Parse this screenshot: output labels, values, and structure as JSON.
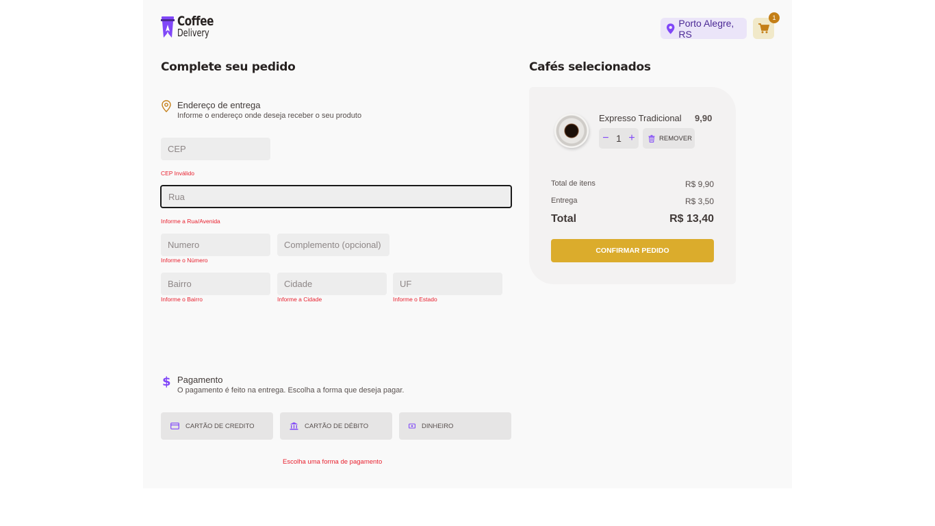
{
  "header": {
    "logo_line1": "Coffee",
    "logo_line2": "Delivery",
    "location": "Porto Alegre, RS",
    "cart_count": "1"
  },
  "order": {
    "title": "Complete seu pedido",
    "address": {
      "heading": "Endereço de entrega",
      "subheading": "Informe o endereço onde deseja receber o seu produto",
      "fields": {
        "cep": {
          "placeholder": "CEP",
          "error": "CEP Inválido"
        },
        "rua": {
          "placeholder": "Rua",
          "error": "Informe a Rua/Avenida"
        },
        "numero": {
          "placeholder": "Numero",
          "error": "Informe o Número"
        },
        "complemento": {
          "placeholder": "Complemento (opcional)"
        },
        "bairro": {
          "placeholder": "Bairro",
          "error": "Informe o Bairro"
        },
        "cidade": {
          "placeholder": "Cidade",
          "error": "Informe a Cidade"
        },
        "uf": {
          "placeholder": "UF",
          "error": "Informe o Estado"
        }
      }
    },
    "payment": {
      "heading": "Pagamento",
      "subheading": "O pagamento é feito na entrega. Escolha a forma que deseja pagar.",
      "options": [
        {
          "label": "CARTÃO DE CREDITO",
          "icon": "credit-card-icon"
        },
        {
          "label": "CARTÃO DE DÉBITO",
          "icon": "bank-icon"
        },
        {
          "label": "DINHEIRO",
          "icon": "money-icon"
        }
      ],
      "error": "Escolha uma forma de pagamento"
    }
  },
  "summary": {
    "title": "Cafés selecionados",
    "item": {
      "name": "Expresso Tradicional",
      "price": "9,90",
      "quantity": "1",
      "remove_label": "REMOVER"
    },
    "totals": {
      "items_label": "Total de itens",
      "items_value": "R$ 9,90",
      "delivery_label": "Entrega",
      "delivery_value": "R$ 3,50",
      "total_label": "Total",
      "total_value": "R$ 13,40"
    },
    "confirm_label": "CONFIRMAR PEDIDO"
  },
  "colors": {
    "purple": "#8047f8",
    "purple_dark": "#4b2995",
    "yellow": "#dbac2c",
    "yellow_dark": "#c47f17",
    "error": "#e8202e"
  }
}
